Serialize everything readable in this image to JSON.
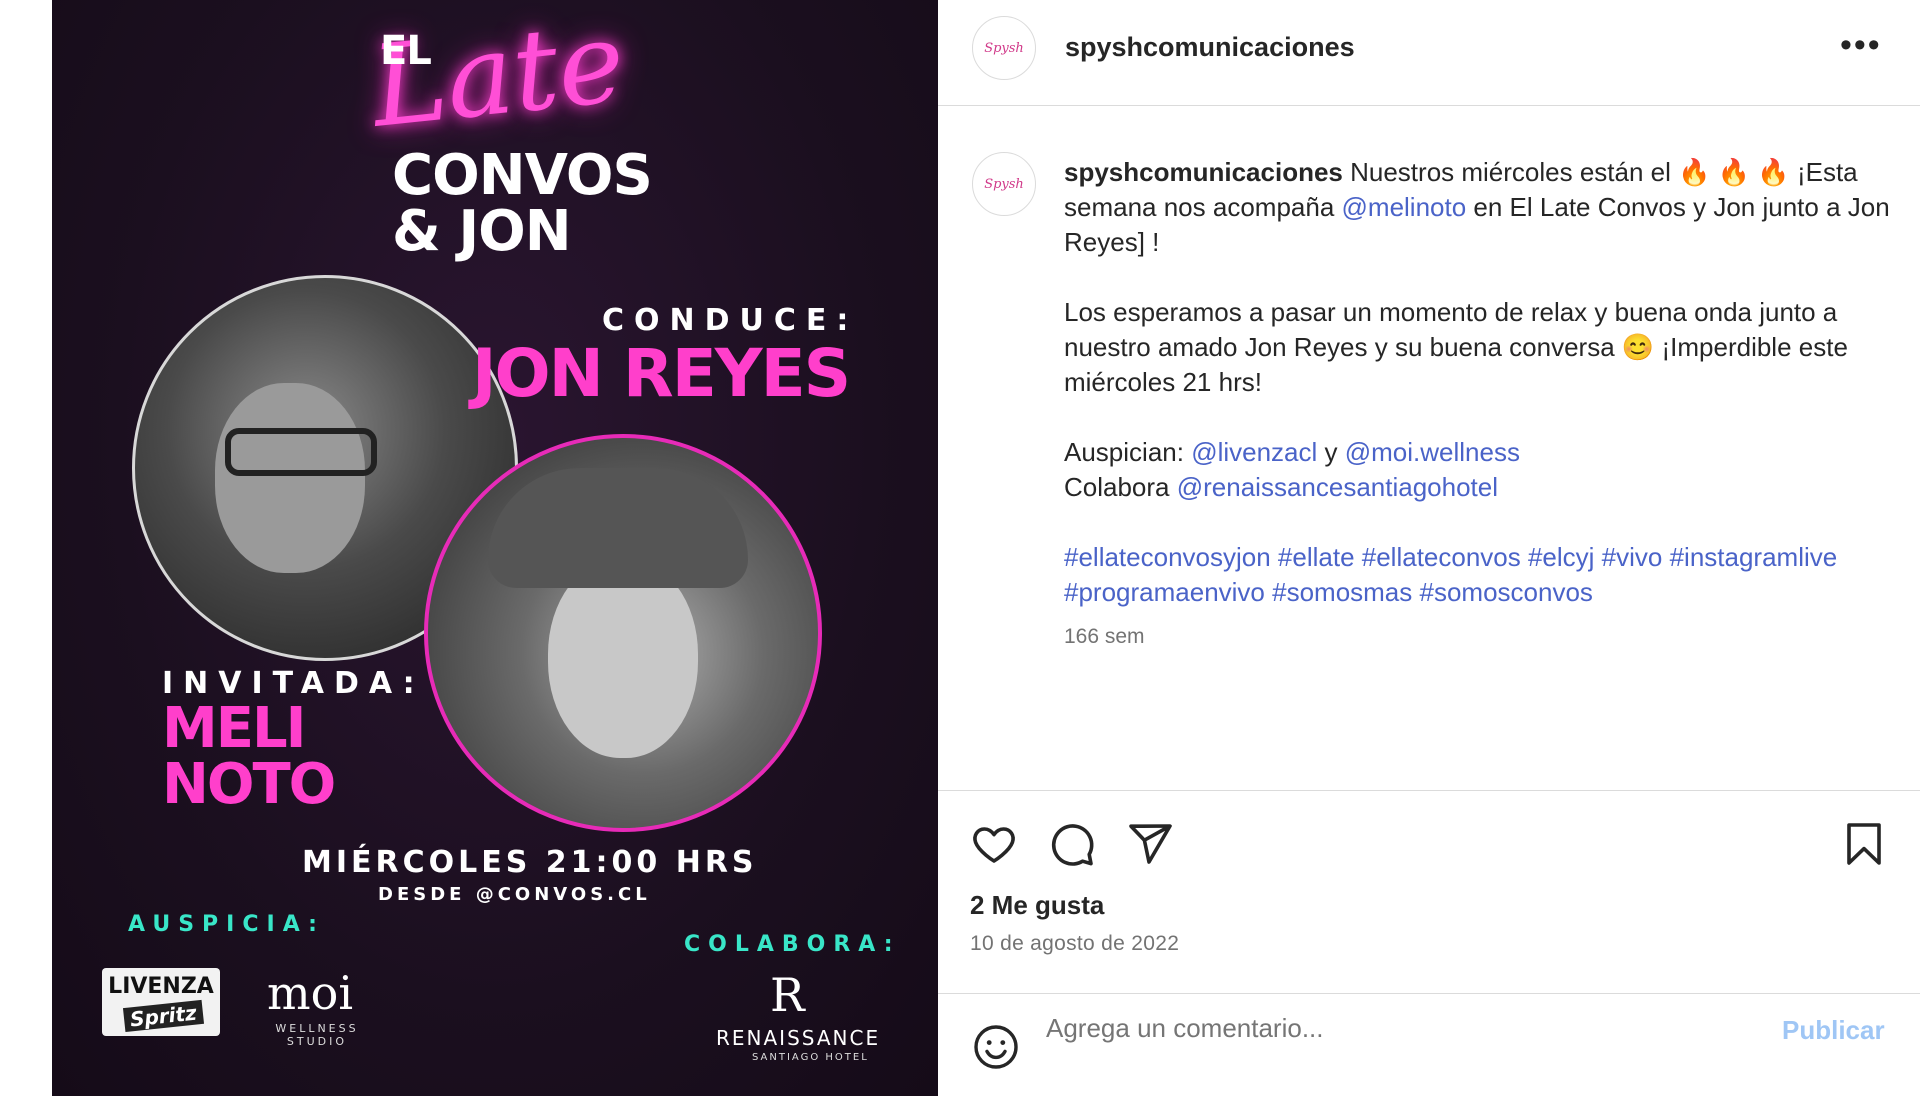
{
  "poster": {
    "title_el": "EL",
    "title_late": "Late",
    "title_convos": "CONVOS",
    "title_jon": "& JON",
    "conduce_label": "CONDUCE:",
    "host": "JON REYES",
    "invitada_label": "INVITADA:",
    "guest_line1": "MELI",
    "guest_line2": "NOTO",
    "schedule": "MIÉRCOLES 21:00 HRS",
    "desde": "DESDE @CONVOS.CL",
    "auspicia_label": "AUSPICIA:",
    "colabora_label": "COLABORA:",
    "sponsor1_line1": "LIVENZA",
    "sponsor1_line2": "Spritz",
    "sponsor2": "moi",
    "sponsor2_sub": "WELLNESS STUDIO",
    "partner_mark": "R",
    "partner": "RENAISSANCE",
    "partner_sub": "SANTIAGO HOTEL",
    "colors": {
      "pink": "#ff3fcb",
      "teal": "#39e6c8",
      "bg": "#1c1020"
    }
  },
  "header": {
    "avatar_text": "Spysh",
    "username": "spyshcomunicaciones",
    "more": "•••"
  },
  "caption": {
    "username": "spyshcomunicaciones",
    "p1_a": " Nuestros miércoles están el ",
    "fire": "🔥",
    "p1_b": " ¡Esta semana nos acompaña ",
    "mention1": "@melinoto",
    "p1_c": " en El Late Convos y Jon junto a Jon Reyes] !",
    "p2_a": "Los esperamos a pasar un momento de relax y buena onda junto a nuestro amado Jon Reyes y su buena conversa ",
    "smile": "😊",
    "p2_b": " ¡Imperdible este miércoles 21 hrs!",
    "auspician_label": "Auspician: ",
    "mention2": "@livenzacl",
    "y": " y ",
    "mention3": "@moi.wellness",
    "colabora_label": "Colabora ",
    "mention4": "@renaissancesantiagohotel",
    "hashtags_line1": "#ellateconvosyjon #ellate #ellateconvos #elcyj #vivo #instagramlive",
    "hashtags_line2": "#programaenvivo #somosmas #somosconvos",
    "time": "166 sem"
  },
  "actions": {
    "likes": "2 Me gusta",
    "date": "10 de agosto de 2022"
  },
  "comment": {
    "placeholder": "Agrega un comentario...",
    "publish": "Publicar"
  }
}
